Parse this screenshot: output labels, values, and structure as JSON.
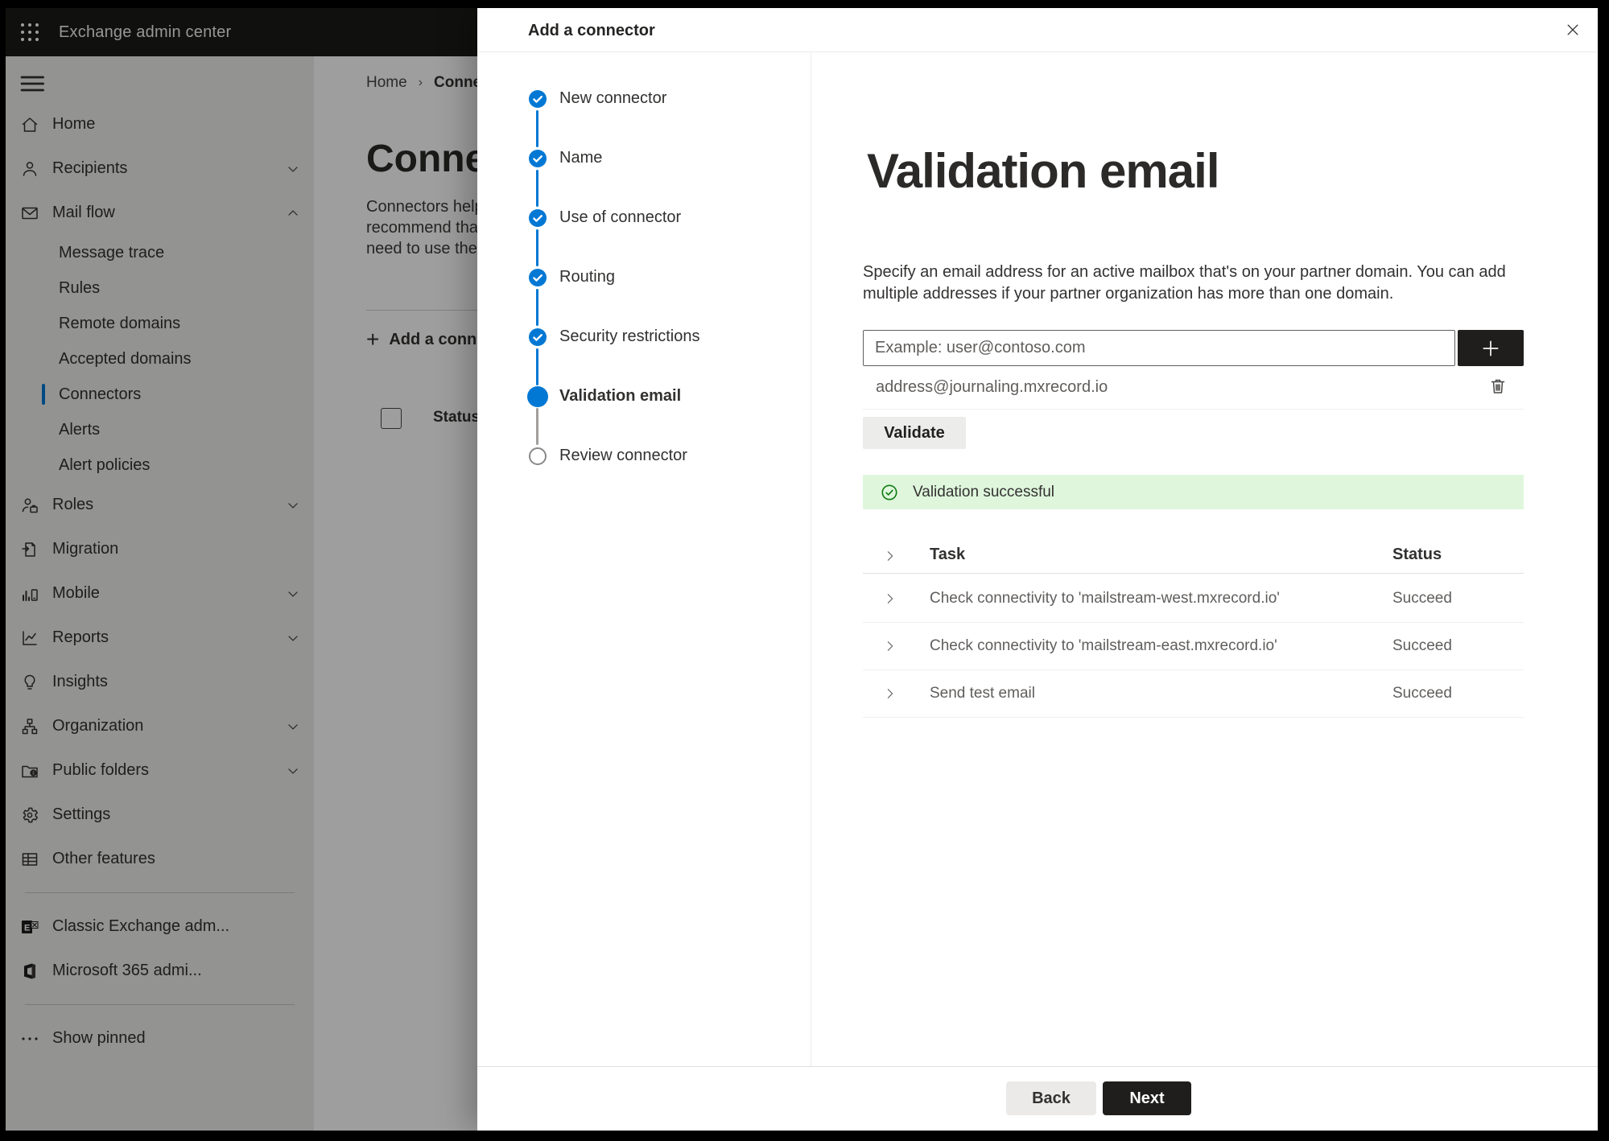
{
  "topbar": {
    "title": "Exchange admin center"
  },
  "sidebar": {
    "items": [
      {
        "label": "Home",
        "icon": "home",
        "type": "top"
      },
      {
        "label": "Recipients",
        "icon": "person",
        "chevron": "down",
        "type": "top"
      },
      {
        "label": "Mail flow",
        "icon": "mail",
        "chevron": "up",
        "type": "top"
      },
      {
        "label": "Message trace",
        "type": "sub"
      },
      {
        "label": "Rules",
        "type": "sub"
      },
      {
        "label": "Remote domains",
        "type": "sub"
      },
      {
        "label": "Accepted domains",
        "type": "sub"
      },
      {
        "label": "Connectors",
        "type": "sub",
        "selected": true
      },
      {
        "label": "Alerts",
        "type": "sub"
      },
      {
        "label": "Alert policies",
        "type": "sub"
      },
      {
        "label": "Roles",
        "icon": "roles",
        "chevron": "down",
        "type": "top"
      },
      {
        "label": "Migration",
        "icon": "migration",
        "type": "top"
      },
      {
        "label": "Mobile",
        "icon": "mobile",
        "chevron": "down",
        "type": "top"
      },
      {
        "label": "Reports",
        "icon": "reports",
        "chevron": "down",
        "type": "top"
      },
      {
        "label": "Insights",
        "icon": "insights",
        "type": "top"
      },
      {
        "label": "Organization",
        "icon": "organization",
        "chevron": "down",
        "type": "top"
      },
      {
        "label": "Public folders",
        "icon": "folders",
        "chevron": "down",
        "type": "top"
      },
      {
        "label": "Settings",
        "icon": "settings",
        "type": "top"
      },
      {
        "label": "Other features",
        "icon": "grid",
        "type": "top"
      },
      {
        "type": "divider"
      },
      {
        "label": "Classic Exchange adm...",
        "icon": "exchange",
        "type": "top"
      },
      {
        "label": "Microsoft 365 admi...",
        "icon": "office",
        "type": "top"
      },
      {
        "type": "divider"
      },
      {
        "label": "Show pinned",
        "icon": "dots",
        "type": "top"
      }
    ]
  },
  "background": {
    "breadcrumb_home": "Home",
    "breadcrumb_current": "Conne",
    "title": "Connec",
    "paragraph_lines": [
      "Connectors help",
      "recommend that",
      "need to use ther"
    ],
    "add_button_label": "Add a conn",
    "status_header": "Status"
  },
  "panel": {
    "title": "Add a connector",
    "steps": [
      {
        "label": "New connector",
        "state": "completed"
      },
      {
        "label": "Name",
        "state": "completed"
      },
      {
        "label": "Use of connector",
        "state": "completed"
      },
      {
        "label": "Routing",
        "state": "completed"
      },
      {
        "label": "Security restrictions",
        "state": "completed"
      },
      {
        "label": "Validation email",
        "state": "current"
      },
      {
        "label": "Review connector",
        "state": "upcoming"
      }
    ],
    "content": {
      "heading": "Validation email",
      "description_line1": "Specify an email address for an active mailbox that's on your partner domain. You can add",
      "description_line2": "multiple addresses if your partner organization has more than one domain.",
      "input_placeholder": "Example: user@contoso.com",
      "address": "address@journaling.mxrecord.io",
      "validate_button": "Validate",
      "banner_text": "Validation successful",
      "table": {
        "task_header": "Task",
        "status_header": "Status",
        "rows": [
          {
            "task": "Check connectivity to 'mailstream-west.mxrecord.io'",
            "status": "Succeed"
          },
          {
            "task": "Check connectivity to 'mailstream-east.mxrecord.io'",
            "status": "Succeed"
          },
          {
            "task": "Send test email",
            "status": "Succeed"
          }
        ]
      },
      "back_button": "Back",
      "next_button": "Next"
    }
  },
  "icons": {
    "waffle": "app-launcher grid of 9 dots",
    "hamburger": "menu bars",
    "home": "house",
    "person": "person",
    "mail": "envelope",
    "roles": "person with briefcase",
    "migration": "page with arrow",
    "mobile": "chart and phone",
    "reports": "line chart",
    "insights": "lightbulb",
    "organization": "org tree",
    "folders": "folder with globe",
    "settings": "gear",
    "grid": "table grid",
    "exchange": "classic exchange logo",
    "office": "microsoft 365 logo",
    "dots": "ellipsis",
    "chevron-down": "chevron down",
    "chevron-up": "chevron up",
    "chevron-right": "chevron right",
    "close": "close x",
    "check": "checkmark",
    "plus": "plus",
    "trash": "trash can",
    "success-check": "circled green checkmark"
  },
  "colors": {
    "accent": "#0078d4",
    "success_bg": "#dff6dd",
    "success_icon": "#107c10",
    "dark_button": "#1f1e1d",
    "topbar_bg": "#1b1a19"
  }
}
